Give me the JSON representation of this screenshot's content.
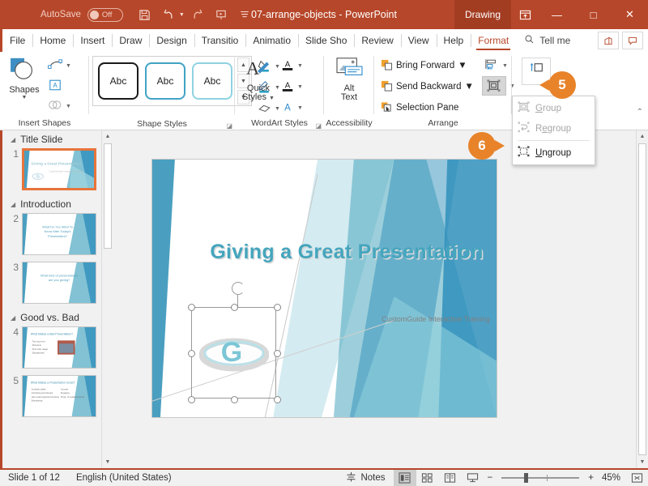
{
  "titlebar": {
    "autosave_label": "AutoSave",
    "autosave_state": "Off",
    "doc_title": "07-arrange-objects  -  PowerPoint",
    "contextual_tab": "Drawing",
    "qat": [
      {
        "name": "save-icon",
        "glyph": "὚B"
      },
      {
        "name": "undo-icon",
        "glyph": "↶"
      },
      {
        "name": "redo-icon",
        "glyph": "↻"
      },
      {
        "name": "start-presentation-icon",
        "glyph": "▶"
      },
      {
        "name": "customize-qat-icon",
        "glyph": "☰"
      }
    ],
    "window_controls": {
      "minimize": "—",
      "maximize": "□",
      "close": "✕"
    },
    "ribbon_display_icon": "ribbon-display-options-icon"
  },
  "tabs": {
    "items": [
      {
        "label": "File",
        "active": false
      },
      {
        "label": "Home",
        "active": false
      },
      {
        "label": "Insert",
        "active": false
      },
      {
        "label": "Draw",
        "active": false
      },
      {
        "label": "Design",
        "active": false
      },
      {
        "label": "Transitio",
        "active": false
      },
      {
        "label": "Animatio",
        "active": false
      },
      {
        "label": "Slide Sho",
        "active": false
      },
      {
        "label": "Review",
        "active": false
      },
      {
        "label": "View",
        "active": false
      },
      {
        "label": "Help",
        "active": false
      },
      {
        "label": "Format",
        "active": true
      }
    ],
    "tell_me": "Tell me",
    "share_icon": "share-icon",
    "comments_icon": "comments-icon"
  },
  "ribbon": {
    "groups": [
      {
        "label": "Insert Shapes"
      },
      {
        "label": "Shape Styles"
      },
      {
        "label": "WordArt Styles"
      },
      {
        "label": "Accessibility"
      },
      {
        "label": "Arrange"
      }
    ],
    "insert_shapes": {
      "shapes_label": "Shapes",
      "edit_shape_icon": "edit-shape-icon",
      "text_box_icon": "text-box-icon",
      "merge_shapes_icon": "merge-shapes-icon"
    },
    "shape_styles": {
      "items": [
        {
          "label": "Abc",
          "variant": "dark"
        },
        {
          "label": "Abc",
          "variant": "blue"
        },
        {
          "label": "Abc",
          "variant": "light"
        }
      ],
      "shape_fill_icon": "shape-fill-icon",
      "shape_outline_icon": "shape-outline-icon",
      "shape_effects_icon": "shape-effects-icon"
    },
    "wordart_styles": {
      "quick_styles_label": "Quick\nStyles",
      "quick_styles_line1": "Quick",
      "quick_styles_line2": "Styles",
      "text_fill_icon": "text-fill-icon",
      "text_outline_icon": "text-outline-icon",
      "text_effects_icon": "text-effects-icon"
    },
    "accessibility": {
      "alt_text_line1": "Alt",
      "alt_text_line2": "Text",
      "alt_text_icon": "alt-text-icon"
    },
    "arrange": {
      "bring_forward": "Bring Forward",
      "send_backward": "Send Backward",
      "selection_pane": "Selection Pane",
      "align_icon": "align-objects-icon",
      "group_icon": "group-objects-icon",
      "rotate_icon": "rotate-objects-icon"
    },
    "collapse_icon": "collapse-ribbon-icon"
  },
  "group_menu": {
    "items": [
      {
        "label": "Group",
        "mnemonic_index": 1,
        "enabled": false,
        "icon": "group-icon"
      },
      {
        "label": "Regroup",
        "mnemonic_index": 2,
        "enabled": false,
        "icon": "regroup-icon"
      },
      {
        "label": "Ungroup",
        "mnemonic_index": 0,
        "enabled": true,
        "icon": "ungroup-icon"
      }
    ]
  },
  "callouts": [
    {
      "number": "5",
      "direction": "left"
    },
    {
      "number": "6",
      "direction": "right"
    }
  ],
  "thumbnails": {
    "sections": [
      {
        "title": "Title Slide",
        "slides": [
          {
            "number": "1",
            "selected": true,
            "title": "Giving a Great Presentation",
            "subtitle": "CustomGuide Interactive Training",
            "kind": "title"
          }
        ]
      },
      {
        "title": "Introduction",
        "slides": [
          {
            "number": "2",
            "selected": false,
            "title": "What Do You Want To Know After Today's Presentation?",
            "kind": "text"
          },
          {
            "number": "3",
            "selected": false,
            "title": "What kind of presentations are you giving?",
            "kind": "text"
          }
        ]
      },
      {
        "title": "Good vs. Bad",
        "slides": [
          {
            "number": "4",
            "selected": false,
            "title": "What Makes a Bad Presentation?",
            "kind": "bullets-image"
          },
          {
            "number": "5",
            "selected": false,
            "title": "What Makes a Presentation Good?",
            "kind": "bullets-two-col"
          }
        ]
      }
    ]
  },
  "slide": {
    "title": "Giving a Great Presentation",
    "subtitle": "CustomGuide Interactive Training",
    "logo_letter": "G",
    "selected_object": "customguide-logo"
  },
  "status": {
    "slide_counter": "Slide 1 of 12",
    "language": "English (United States)",
    "notes_label": "Notes",
    "views": [
      {
        "name": "normal-view-button",
        "active": true
      },
      {
        "name": "slide-sorter-button",
        "active": false
      },
      {
        "name": "reading-view-button",
        "active": false
      },
      {
        "name": "slideshow-button",
        "active": false
      }
    ],
    "zoom_out": "−",
    "zoom_in": "+",
    "zoom_level": "45%",
    "fit_slide_icon": "fit-slide-to-window-icon"
  },
  "colors": {
    "accent_red": "#b7472a",
    "callout_orange": "#e8832a",
    "slide_teal": "#45a5bd",
    "selection_orange": "#e8743b"
  }
}
